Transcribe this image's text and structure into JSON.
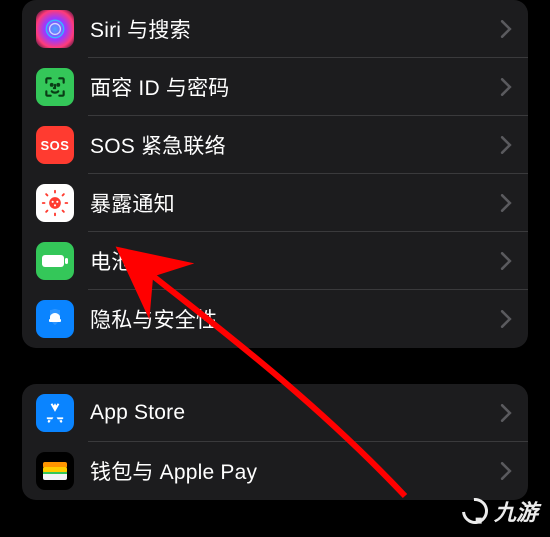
{
  "sections": [
    {
      "rows": [
        {
          "id": "siri",
          "label": "Siri 与搜索",
          "iconName": "siri-icon"
        },
        {
          "id": "faceid",
          "label": "面容 ID 与密码",
          "iconName": "faceid-icon"
        },
        {
          "id": "sos",
          "label": "SOS 紧急联络",
          "iconName": "sos-icon",
          "iconText": "SOS"
        },
        {
          "id": "exposure",
          "label": "暴露通知",
          "iconName": "exposure-icon"
        },
        {
          "id": "battery",
          "label": "电池",
          "iconName": "battery-icon"
        },
        {
          "id": "privacy",
          "label": "隐私与安全性",
          "iconName": "privacy-icon"
        }
      ]
    },
    {
      "rows": [
        {
          "id": "appstore",
          "label": "App Store",
          "iconName": "appstore-icon"
        },
        {
          "id": "wallet",
          "label": "钱包与 Apple Pay",
          "iconName": "wallet-icon"
        }
      ]
    }
  ],
  "annotation": {
    "arrowColor": "#ff0000"
  },
  "watermark": {
    "text": "九游"
  }
}
